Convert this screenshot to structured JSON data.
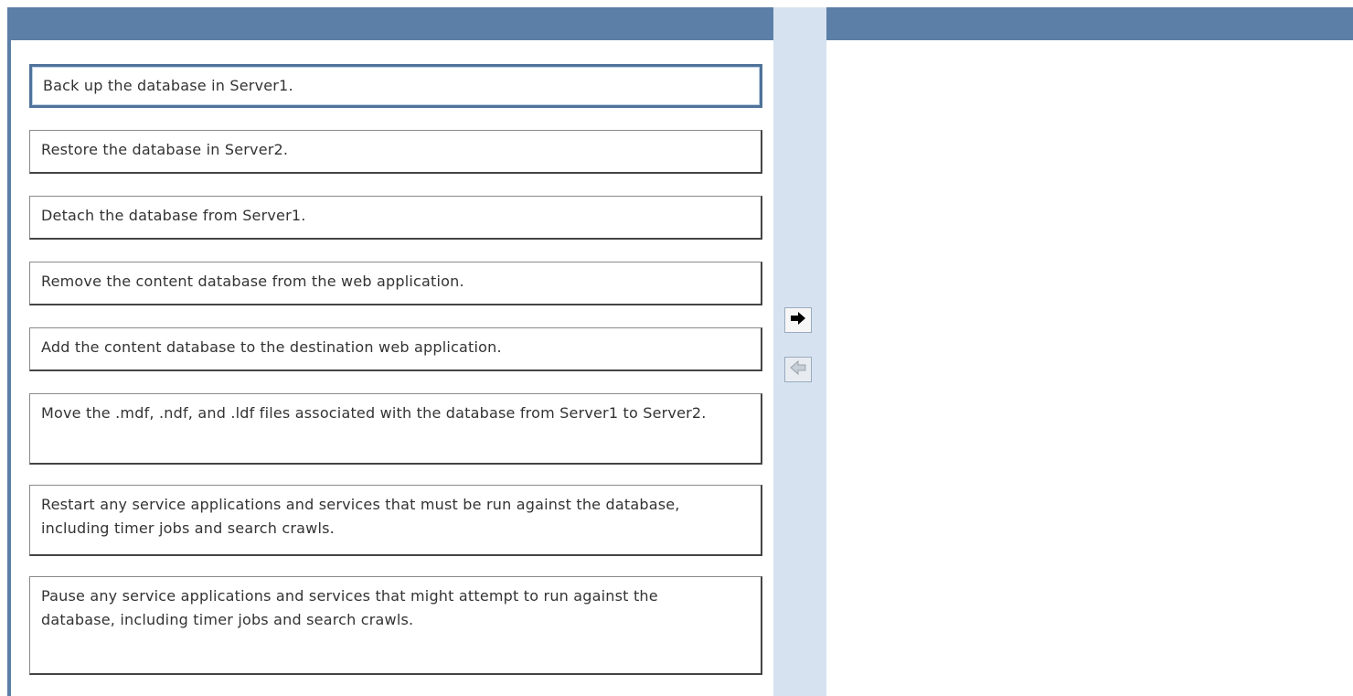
{
  "left_list": {
    "items": [
      {
        "label": "Back up the database in Server1.",
        "selected": true
      },
      {
        "label": "Restore the database in Server2."
      },
      {
        "label": "Detach the database from Server1."
      },
      {
        "label": "Remove the content database from the web application."
      },
      {
        "label": "Add the content database to the destination web application."
      },
      {
        "label": "Move the .mdf, .ndf, and .ldf files associated with the database from Server1 to Server2."
      },
      {
        "label": "Restart any service applications and services that must be run against the database, including timer jobs and search crawls."
      },
      {
        "label": "Pause any service applications and services that might attempt to run against the database, including timer jobs and search crawls."
      }
    ]
  },
  "controls": {
    "move_right_icon": "arrow-right-icon",
    "move_left_icon": "arrow-left-icon"
  },
  "colors": {
    "header": "#5b7fa6",
    "middle_column": "#d6e2ef",
    "selected_border": "#4f7399"
  }
}
